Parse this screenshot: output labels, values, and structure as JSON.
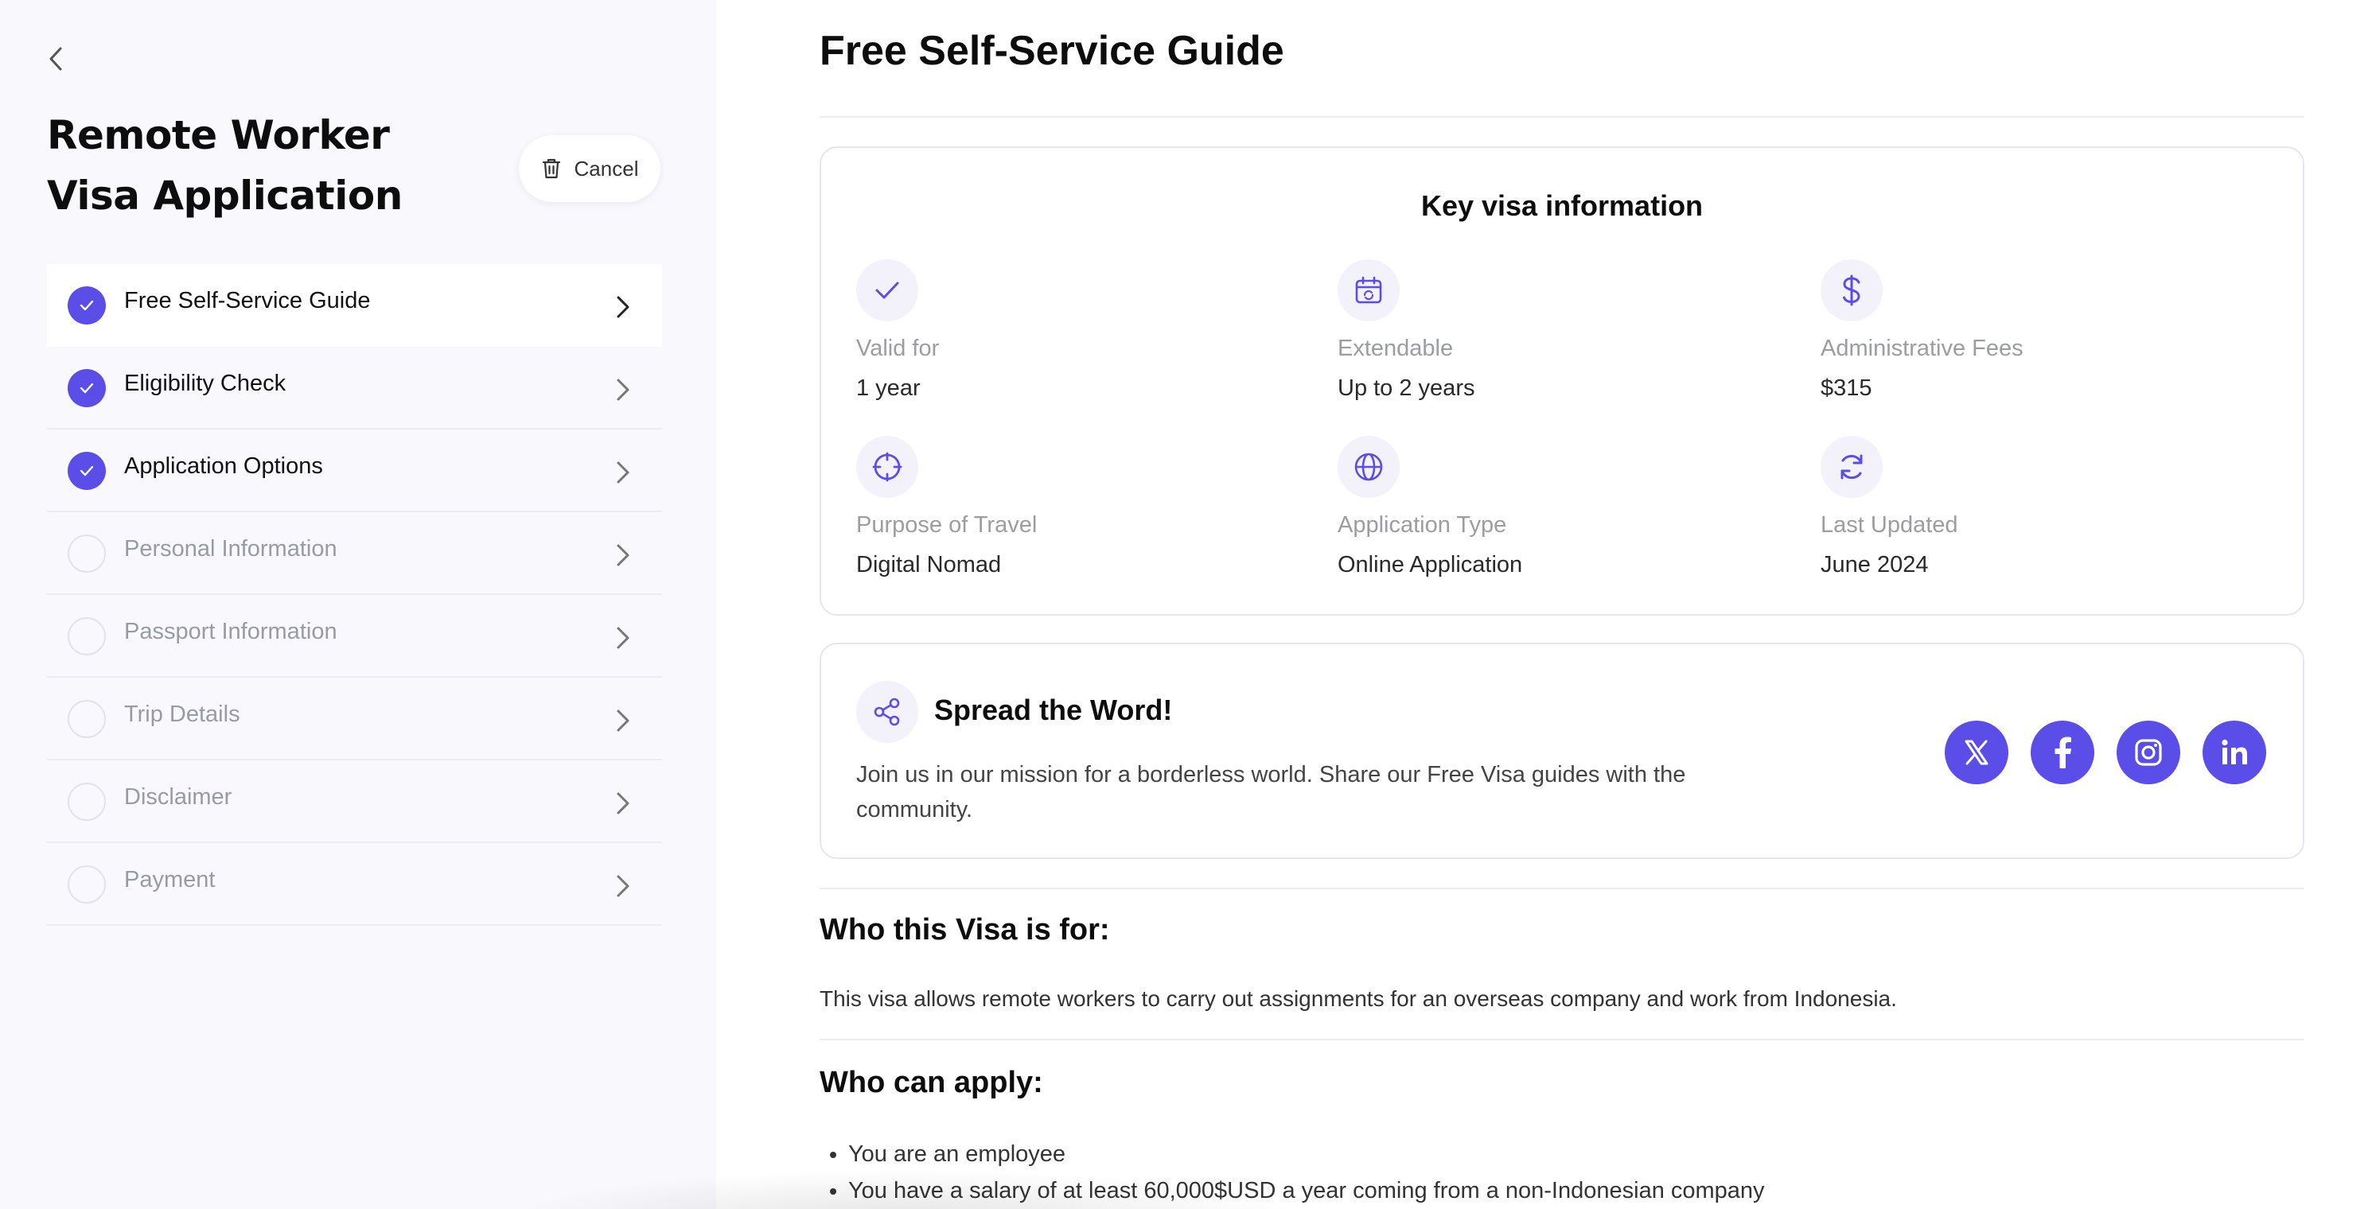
{
  "sidebar": {
    "title": "Remote Worker Visa Application",
    "cancel_label": "Cancel",
    "steps": [
      {
        "label": "Free Self-Service Guide",
        "status": "done"
      },
      {
        "label": "Eligibility Check",
        "status": "done"
      },
      {
        "label": "Application Options",
        "status": "done"
      },
      {
        "label": "Personal Information",
        "status": "todo"
      },
      {
        "label": "Passport Information",
        "status": "todo"
      },
      {
        "label": "Trip Details",
        "status": "todo"
      },
      {
        "label": "Disclaimer",
        "status": "todo"
      },
      {
        "label": "Payment",
        "status": "todo"
      }
    ]
  },
  "main": {
    "title": "Free Self-Service Guide",
    "key_info": {
      "heading": "Key visa information",
      "items": [
        {
          "icon": "check-icon",
          "label": "Valid for",
          "value": "1 year"
        },
        {
          "icon": "calendar-refresh-icon",
          "label": "Extendable",
          "value": "Up to 2 years"
        },
        {
          "icon": "dollar-icon",
          "label": "Administrative Fees",
          "value": "$315"
        },
        {
          "icon": "crosshair-icon",
          "label": "Purpose of Travel",
          "value": "Digital Nomad"
        },
        {
          "icon": "globe-icon",
          "label": "Application Type",
          "value": "Online Application"
        },
        {
          "icon": "refresh-icon",
          "label": "Last Updated",
          "value": "June 2024"
        }
      ]
    },
    "share": {
      "title": "Spread the Word!",
      "text": "Join us in our mission for a borderless world. Share our Free Visa guides with the community.",
      "socials": [
        "x-icon",
        "facebook-icon",
        "instagram-icon",
        "linkedin-icon"
      ]
    },
    "who_for": {
      "heading": "Who this Visa is for:",
      "text": "This visa allows remote workers to carry out assignments for an overseas company and work from Indonesia."
    },
    "who_can_apply": {
      "heading": "Who can apply:",
      "items": [
        "You are an employee",
        "You have a salary of at least 60,000$USD a year coming from a non-Indonesian company"
      ]
    }
  },
  "colors": {
    "accent": "#5b4de8",
    "sidebar_bg": "#f8f8fd",
    "muted_text": "#9c9ca4"
  }
}
